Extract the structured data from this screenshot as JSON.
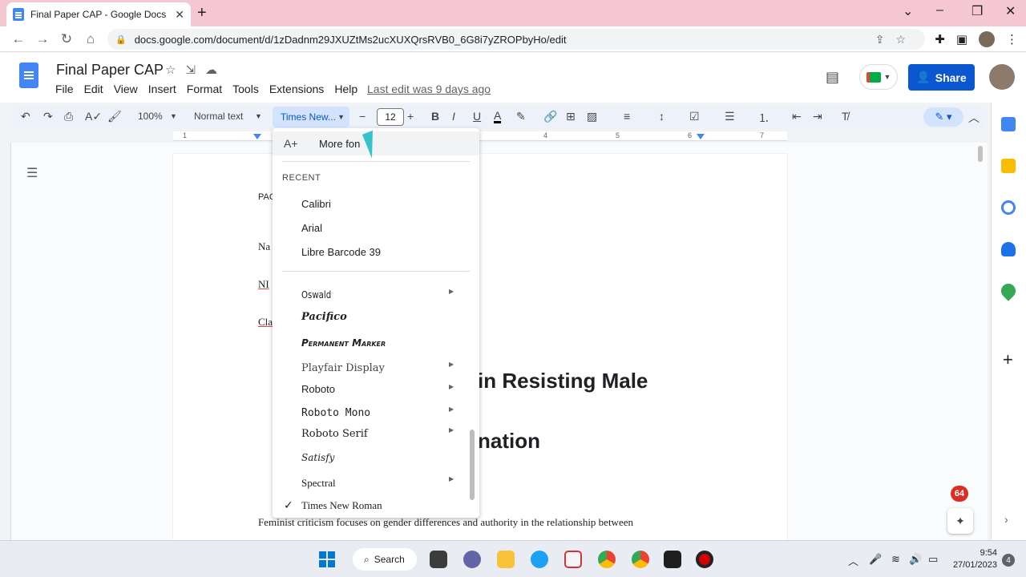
{
  "browser": {
    "tab_title": "Final Paper CAP - Google Docs",
    "url": "docs.google.com/document/d/1zDadnm29JXUZtMs2ucXUXQrsRVB0_6G8i7yZROPbyHo/edit"
  },
  "docs": {
    "title": "Final Paper CAP",
    "menu": [
      "File",
      "Edit",
      "View",
      "Insert",
      "Format",
      "Tools",
      "Extensions",
      "Help"
    ],
    "last_edit": "Last edit was 9 days ago",
    "share_label": "Share"
  },
  "toolbar": {
    "zoom": "100%",
    "style": "Normal text",
    "font": "Times New...",
    "size": "12"
  },
  "ruler": [
    "1",
    "4",
    "5",
    "6",
    "7"
  ],
  "document": {
    "line_pac": "PAC",
    "line_na": "Na",
    "line_ni": "NI",
    "line_cla": "Cla",
    "heading_1": "in Resisting Male",
    "heading_2": "nation",
    "body": "Feminist criticism focuses on gender differences and authority in the relationship between"
  },
  "font_menu": {
    "more_fonts": "More fon",
    "recent_label": "RECENT",
    "recent": [
      "Calibri",
      "Arial",
      "Libre Barcode 39"
    ],
    "fonts": [
      "Oswald",
      "Pacifico",
      "Permanent Marker",
      "Playfair Display",
      "Roboto",
      "Roboto Mono",
      "Roboto Serif",
      "Satisfy",
      "Spectral",
      "Times New Roman"
    ],
    "selected": "Times New Roman"
  },
  "side": {
    "badge": "64"
  },
  "taskbar": {
    "search": "Search",
    "time": "9:54",
    "date": "27/01/2023",
    "notifications": "4"
  },
  "colors": {
    "accent": "#0b57d0",
    "tabstrip": "#f4c7d2",
    "cursor": "#35c2c8"
  }
}
